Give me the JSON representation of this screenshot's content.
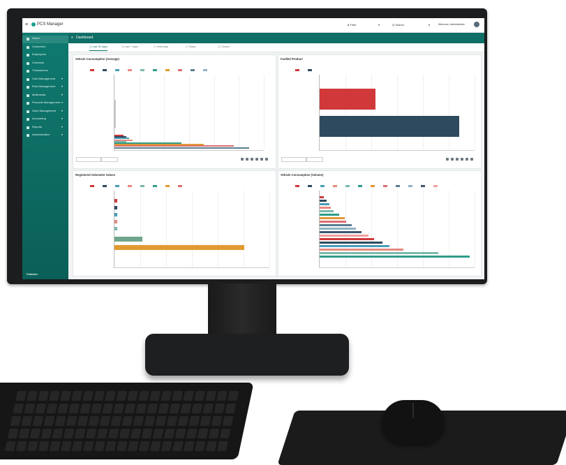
{
  "app": {
    "name": "PCS Manager"
  },
  "topbar": {
    "filter_label": "● Filter",
    "search_label": "Q Search",
    "user_label": "Welcome, Administrator"
  },
  "sidebar": {
    "items": [
      {
        "label": "Home",
        "chevron": false,
        "active": true
      },
      {
        "label": "Customers",
        "chevron": false
      },
      {
        "label": "Employees",
        "chevron": false
      },
      {
        "label": "Contracts",
        "chevron": false
      },
      {
        "label": "Transactions",
        "chevron": false
      },
      {
        "label": "Card Management",
        "chevron": true
      },
      {
        "label": "Fleet Management",
        "chevron": true
      },
      {
        "label": "Multimedia",
        "chevron": true
      },
      {
        "label": "Products Management",
        "chevron": true
      },
      {
        "label": "Store Management",
        "chevron": true
      },
      {
        "label": "Accounting",
        "chevron": true
      },
      {
        "label": "Reports",
        "chevron": true
      },
      {
        "label": "Administration",
        "chevron": true
      }
    ],
    "footer_brand": "Fabiatec"
  },
  "header": {
    "title": "Dashboard"
  },
  "tabs": [
    "Last 30 days",
    "Last 7 days",
    "Yesterday",
    "Today",
    "Custom"
  ],
  "colors": {
    "accent": "#0f6e66",
    "series": [
      "#d1383a",
      "#2e4a5e",
      "#4a9cb8",
      "#e7897e",
      "#7ab9ad",
      "#2f9c8a",
      "#e19a30",
      "#d96f72",
      "#5a7d8f",
      "#8fb2c4",
      "#3b5770",
      "#f0a0a0"
    ]
  },
  "panels": {
    "tl": {
      "title": "Vehicle Consumption (Average)"
    },
    "tr": {
      "title": "Fuelled Product"
    },
    "bl": {
      "title": "Registered Odometer Values"
    },
    "br": {
      "title": "Vehicle Consumption (Volume)"
    }
  }
}
